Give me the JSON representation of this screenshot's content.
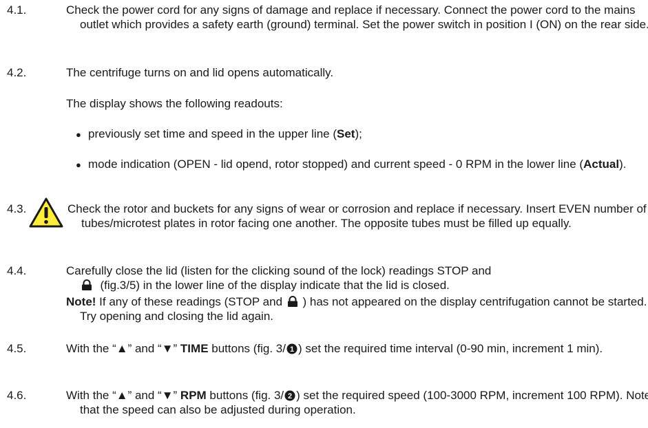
{
  "sections": [
    {
      "num": "4.1.",
      "text": "Check the power cord for any signs of damage and replace if necessary. Connect the power cord to the mains outlet which provides a safety earth (ground) terminal. Set the power switch in position I (ON) on the rear side."
    },
    {
      "num": "4.2.",
      "text": "The centrifuge turns on and lid opens automatically."
    },
    {
      "num": "4.3.",
      "text": "Check the rotor and buckets for any signs of wear or corrosion and replace if necessary. Insert EVEN number of tubes/microtest plates in rotor facing one another. The opposite tubes must be filled up equally."
    },
    {
      "num": "4.4.",
      "text_a": "Carefully close the lid (listen for the clicking sound of the lock) readings STOP and",
      "text_b": "(fig.3/5) in the lower line of the display indicate that the lid is closed."
    },
    {
      "num": "4.5.",
      "pre": "With the “▲” and “▼” ",
      "bold": "TIME",
      "mid": " buttons (fig. 3/",
      "post": ") set the required time interval (0-90 min, increment 1 min)."
    },
    {
      "num": "4.6.",
      "pre": "With the “▲” and “▼” ",
      "bold": "RPM",
      "mid": " buttons (fig. 3/",
      "post": ") set the required speed (100-3000 RPM, increment 100 RPM). Note that the speed can also be adjusted during operation."
    }
  ],
  "display_intro": "The display shows the following readouts:",
  "bullets": [
    {
      "pre": "previously set time and speed in the upper line (",
      "bold": "Set",
      "post": ");"
    },
    {
      "pre": "mode indication (OPEN - lid opend, rotor stopped) and current speed - 0 RPM in the lower line (",
      "bold": "Actual",
      "post": ")."
    }
  ],
  "note": {
    "bold": "Note!",
    "pre": " If any of these readings  (STOP and ",
    "post": " ) has not appeared on the display centrifugation cannot be started. Try opening and closing the lid again."
  },
  "icons": {
    "warning": "warning-triangle-icon",
    "lock": "padlock-icon",
    "circle_1": "circled-1-icon",
    "circle_2": "circled-2-icon"
  },
  "circle_labels": {
    "one": "1",
    "two": "2"
  },
  "colors": {
    "warning_fill": "#ffef3a",
    "text": "#1a1a1a"
  }
}
